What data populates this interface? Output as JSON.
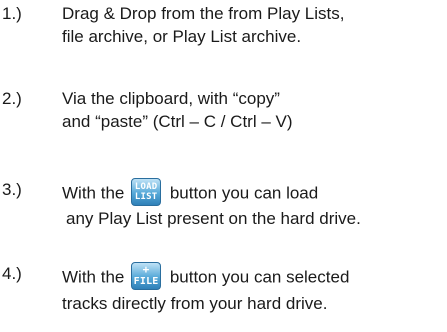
{
  "items": [
    {
      "number": "1.)",
      "lines": [
        "Drag & Drop from the from Play Lists,",
        "file archive, or Play List archive."
      ]
    },
    {
      "number": "2.)",
      "lines": [
        "Via the clipboard, with “copy”",
        "and “paste” (Ctrl – C / Ctrl – V)"
      ]
    },
    {
      "number": "3.)",
      "pre": "With the",
      "post": "button you can load",
      "line2": " any Play List present on the hard drive.",
      "button": {
        "icon": "load-list-icon",
        "line1": "LOAD",
        "line2": "LIST"
      }
    },
    {
      "number": "4.)",
      "pre": "With the",
      "post": "button you can selected",
      "line2": "tracks directly from your hard drive.",
      "button": {
        "icon": "add-file-icon",
        "line1": "+",
        "line2": "FILE"
      }
    }
  ]
}
